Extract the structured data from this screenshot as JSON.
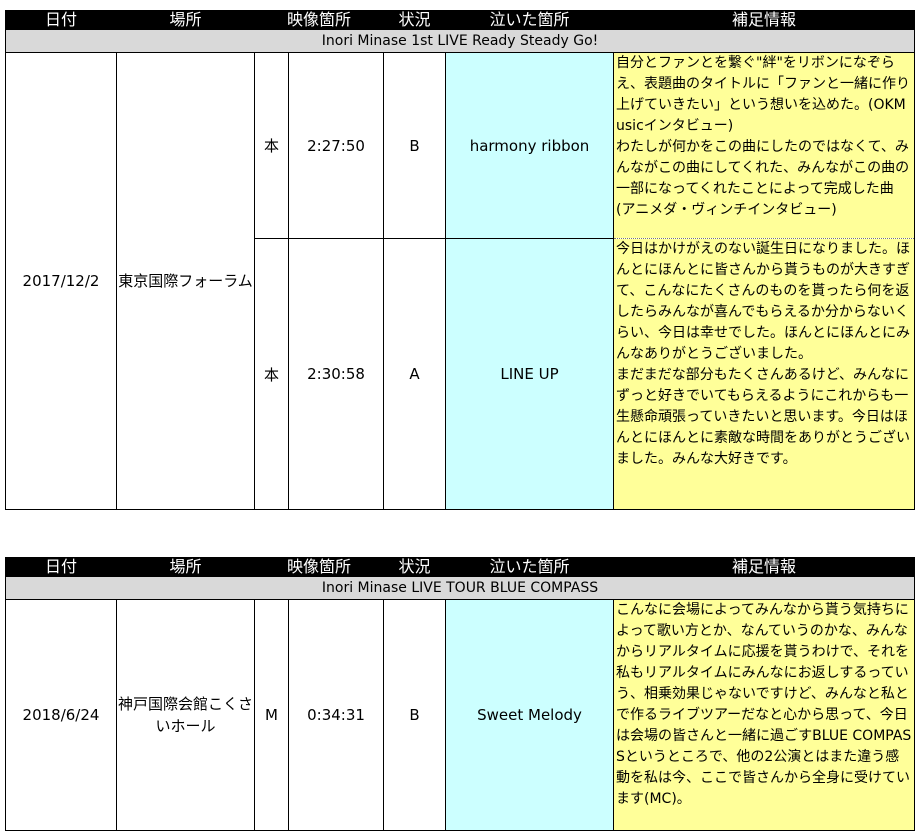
{
  "headers": [
    "日付",
    "場所",
    "映像箇所",
    "状況",
    "泣いた箇所",
    "補足情報"
  ],
  "tables": [
    {
      "title": "Inori Minase 1st LIVE Ready Steady Go!",
      "date": "2017/12/2",
      "venue": "東京国際フォーラム",
      "rows": [
        {
          "source": "本",
          "time": "2:27:50",
          "status": "B",
          "song": "harmony ribbon",
          "note": "自分とファンとを繋ぐ\"絆\"をリボンになぞらえ、表題曲のタイトルに「ファンと一緒に作り上げていきたい」という想いを込めた。(OKMusicインタビュー)\nわたしが何かをこの曲にしたのではなくて、みんながこの曲にしてくれた、みんながこの曲の一部になってくれたことによって完成した曲(アニメダ・ヴィンチインタビュー)"
        },
        {
          "source": "本",
          "time": "2:30:58",
          "status": "A",
          "song": "LINE UP",
          "note": "今日はかけがえのない誕生日になりました。ほんとにほんとに皆さんから貰うものが大きすぎて、こんなにたくさんのものを貰ったら何を返したらみんなが喜んでもらえるか分からないくらい、今日は幸せでした。ほんとにほんとにみんなありがとうございました。\nまだまだな部分もたくさんあるけど、みんなにずっと好きでいてもらえるようにこれからも一生懸命頑張っていきたいと思います。今日はほんとにほんとに素敵な時間をありがとうございました。みんな大好きです。"
        }
      ]
    },
    {
      "title": "Inori Minase LIVE TOUR BLUE COMPASS",
      "date": "2018/6/24",
      "venue": "神戸国際会館こくさいホール",
      "rows": [
        {
          "source": "M",
          "time": "0:34:31",
          "status": "B",
          "song": "Sweet Melody",
          "note": "こんなに会場によってみんなから貰う気持ちによって歌い方とか、なんていうのかな、みんなからリアルタイムに応援を貰うわけで、それを私もリアルタイムにみんなにお返しするっていう、相乗効果じゃないですけど、みんなと私とで作るライブツアーだなと心から思って、今日は会場の皆さんと一緒に過ごすBLUE COMPASSというところで、他の2公演とはまた違う感動を私は今、ここで皆さんから全身に受けています(MC)。"
        }
      ]
    }
  ]
}
